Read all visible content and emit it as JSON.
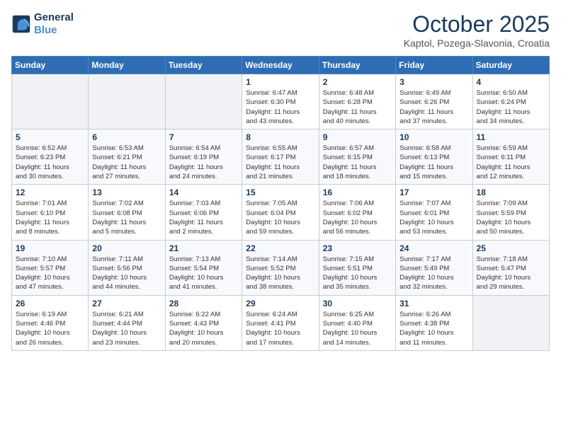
{
  "header": {
    "logo_line1": "General",
    "logo_line2": "Blue",
    "month": "October 2025",
    "location": "Kaptol, Pozega-Slavonia, Croatia"
  },
  "weekdays": [
    "Sunday",
    "Monday",
    "Tuesday",
    "Wednesday",
    "Thursday",
    "Friday",
    "Saturday"
  ],
  "weeks": [
    [
      {
        "day": "",
        "info": ""
      },
      {
        "day": "",
        "info": ""
      },
      {
        "day": "",
        "info": ""
      },
      {
        "day": "1",
        "info": "Sunrise: 6:47 AM\nSunset: 6:30 PM\nDaylight: 11 hours\nand 43 minutes."
      },
      {
        "day": "2",
        "info": "Sunrise: 6:48 AM\nSunset: 6:28 PM\nDaylight: 11 hours\nand 40 minutes."
      },
      {
        "day": "3",
        "info": "Sunrise: 6:49 AM\nSunset: 6:26 PM\nDaylight: 11 hours\nand 37 minutes."
      },
      {
        "day": "4",
        "info": "Sunrise: 6:50 AM\nSunset: 6:24 PM\nDaylight: 11 hours\nand 34 minutes."
      }
    ],
    [
      {
        "day": "5",
        "info": "Sunrise: 6:52 AM\nSunset: 6:23 PM\nDaylight: 11 hours\nand 30 minutes."
      },
      {
        "day": "6",
        "info": "Sunrise: 6:53 AM\nSunset: 6:21 PM\nDaylight: 11 hours\nand 27 minutes."
      },
      {
        "day": "7",
        "info": "Sunrise: 6:54 AM\nSunset: 6:19 PM\nDaylight: 11 hours\nand 24 minutes."
      },
      {
        "day": "8",
        "info": "Sunrise: 6:55 AM\nSunset: 6:17 PM\nDaylight: 11 hours\nand 21 minutes."
      },
      {
        "day": "9",
        "info": "Sunrise: 6:57 AM\nSunset: 6:15 PM\nDaylight: 11 hours\nand 18 minutes."
      },
      {
        "day": "10",
        "info": "Sunrise: 6:58 AM\nSunset: 6:13 PM\nDaylight: 11 hours\nand 15 minutes."
      },
      {
        "day": "11",
        "info": "Sunrise: 6:59 AM\nSunset: 6:11 PM\nDaylight: 11 hours\nand 12 minutes."
      }
    ],
    [
      {
        "day": "12",
        "info": "Sunrise: 7:01 AM\nSunset: 6:10 PM\nDaylight: 11 hours\nand 8 minutes."
      },
      {
        "day": "13",
        "info": "Sunrise: 7:02 AM\nSunset: 6:08 PM\nDaylight: 11 hours\nand 5 minutes."
      },
      {
        "day": "14",
        "info": "Sunrise: 7:03 AM\nSunset: 6:06 PM\nDaylight: 11 hours\nand 2 minutes."
      },
      {
        "day": "15",
        "info": "Sunrise: 7:05 AM\nSunset: 6:04 PM\nDaylight: 10 hours\nand 59 minutes."
      },
      {
        "day": "16",
        "info": "Sunrise: 7:06 AM\nSunset: 6:02 PM\nDaylight: 10 hours\nand 56 minutes."
      },
      {
        "day": "17",
        "info": "Sunrise: 7:07 AM\nSunset: 6:01 PM\nDaylight: 10 hours\nand 53 minutes."
      },
      {
        "day": "18",
        "info": "Sunrise: 7:09 AM\nSunset: 5:59 PM\nDaylight: 10 hours\nand 50 minutes."
      }
    ],
    [
      {
        "day": "19",
        "info": "Sunrise: 7:10 AM\nSunset: 5:57 PM\nDaylight: 10 hours\nand 47 minutes."
      },
      {
        "day": "20",
        "info": "Sunrise: 7:11 AM\nSunset: 5:56 PM\nDaylight: 10 hours\nand 44 minutes."
      },
      {
        "day": "21",
        "info": "Sunrise: 7:13 AM\nSunset: 5:54 PM\nDaylight: 10 hours\nand 41 minutes."
      },
      {
        "day": "22",
        "info": "Sunrise: 7:14 AM\nSunset: 5:52 PM\nDaylight: 10 hours\nand 38 minutes."
      },
      {
        "day": "23",
        "info": "Sunrise: 7:15 AM\nSunset: 5:51 PM\nDaylight: 10 hours\nand 35 minutes."
      },
      {
        "day": "24",
        "info": "Sunrise: 7:17 AM\nSunset: 5:49 PM\nDaylight: 10 hours\nand 32 minutes."
      },
      {
        "day": "25",
        "info": "Sunrise: 7:18 AM\nSunset: 5:47 PM\nDaylight: 10 hours\nand 29 minutes."
      }
    ],
    [
      {
        "day": "26",
        "info": "Sunrise: 6:19 AM\nSunset: 4:46 PM\nDaylight: 10 hours\nand 26 minutes."
      },
      {
        "day": "27",
        "info": "Sunrise: 6:21 AM\nSunset: 4:44 PM\nDaylight: 10 hours\nand 23 minutes."
      },
      {
        "day": "28",
        "info": "Sunrise: 6:22 AM\nSunset: 4:43 PM\nDaylight: 10 hours\nand 20 minutes."
      },
      {
        "day": "29",
        "info": "Sunrise: 6:24 AM\nSunset: 4:41 PM\nDaylight: 10 hours\nand 17 minutes."
      },
      {
        "day": "30",
        "info": "Sunrise: 6:25 AM\nSunset: 4:40 PM\nDaylight: 10 hours\nand 14 minutes."
      },
      {
        "day": "31",
        "info": "Sunrise: 6:26 AM\nSunset: 4:38 PM\nDaylight: 10 hours\nand 11 minutes."
      },
      {
        "day": "",
        "info": ""
      }
    ]
  ]
}
